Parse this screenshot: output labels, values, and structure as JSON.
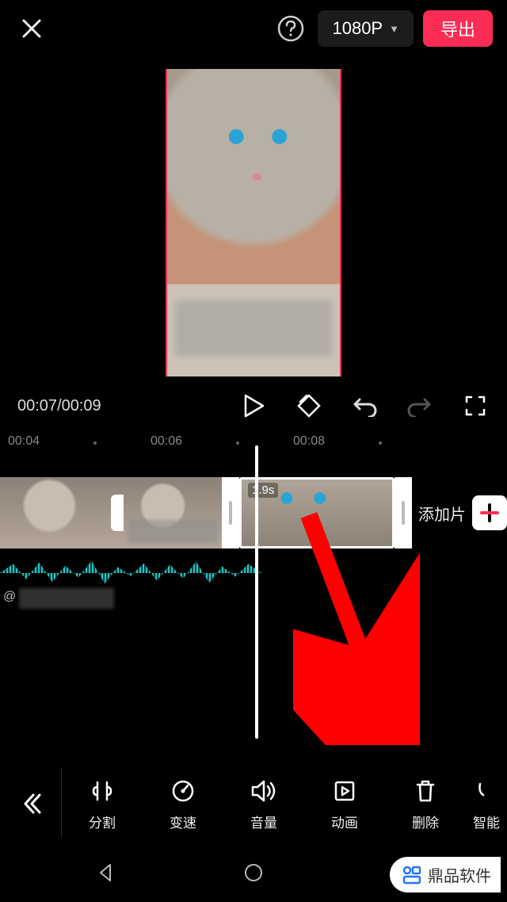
{
  "header": {
    "resolution_label": "1080P",
    "export_label": "导出"
  },
  "playback": {
    "current_time": "00:07",
    "total_time": "00:09"
  },
  "ruler": {
    "ticks": [
      "00:04",
      "00:06",
      "00:08"
    ]
  },
  "timeline": {
    "selected_clip_duration": "1.9s",
    "add_clip_label": "添加片",
    "audio_prefix": "@"
  },
  "toolbar": {
    "items": [
      {
        "name": "split",
        "label": "分割"
      },
      {
        "name": "speed",
        "label": "变速"
      },
      {
        "name": "volume",
        "label": "音量"
      },
      {
        "name": "animation",
        "label": "动画"
      },
      {
        "name": "delete",
        "label": "删除"
      },
      {
        "name": "smart",
        "label": "智能"
      }
    ]
  },
  "watermark": {
    "text": "鼎品软件"
  }
}
